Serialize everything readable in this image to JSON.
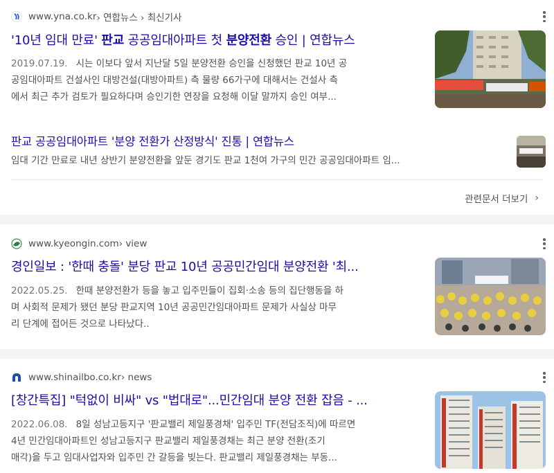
{
  "results": [
    {
      "source": "www.yna.co.kr",
      "path": " › 연합뉴스 › 최신기사",
      "title_pre": "'10년 임대 만료' ",
      "title_b1": "판교",
      "title_mid": " 공공임대아파트 첫 ",
      "title_b2": "분양전환",
      "title_post": " 승인 | 연합뉴스",
      "date": "2019.07.19.",
      "snippet_lines": [
        "시는 이보다 앞서 지난달 5일 분양전환 승인을 신청했던 판교 10년 공",
        "공임대아파트 건설사인 대방건설(대방아파트) 측 물량 66가구에 대해서는 건설사 측",
        "에서 최근 추가 검토가 필요하다며 승인기한 연장을 요청해 이달 말까지 승인 여부..."
      ],
      "sub_title": "판교 공공임대아파트 '분양 전환가 산정방식' 진통 | 연합뉴스",
      "sub_snippet": "임대 기간 만료로 내년 상반기 분양전환을 앞둔 경기도 판교 1천여 가구의 민간 공공임대아파트 임...",
      "more_label": "관련문서 더보기"
    },
    {
      "source": "www.kyeongin.com",
      "path": " › view",
      "title": "경인일보 : '한때 충돌' 분당 판교 10년 공공민간임대 분양전환 '최...",
      "date": "2022.05.25.",
      "snippet_lines": [
        "한때 분양전환가 등을 놓고 입주민들이 집회·소송 등의 집단행동을 하",
        "며 사회적 문제가 됐던 분당 판교지역 10년 공공민간임대아파트 문제가 사실상 마무",
        "리 단계에 접어든 것으로 나타났다.."
      ]
    },
    {
      "source": "www.shinailbo.co.kr",
      "path": " › news",
      "title": "[창간특집] \"턱없이 비싸\" vs \"법대로\"...민간임대 분양 전환 잡음 - ...",
      "date": "2022.06.08.",
      "snippet_lines": [
        "8일 성남고등지구 '판교밸리 제일풍경채' 입주민 TF(전담조직)에 따르면",
        "4년 민간임대아파트인 성남고등지구 판교밸리 제일풍경채는 최근 분양 전환(조기",
        "매각)을 두고 임대사업자와 입주민 간 갈등을 빚는다. 판교밸리 제일풍경채는 부동..."
      ]
    }
  ],
  "icons": {
    "yna": "yna-favicon-icon",
    "kyeongin": "kyeongin-favicon-icon",
    "shinailbo": "shinailbo-favicon-icon",
    "more": "more-vert-icon",
    "chevron": "chevron-right-icon"
  },
  "colors": {
    "link": "#1a0dab",
    "text": "#4d5156",
    "bg": "#f1f3f4"
  }
}
